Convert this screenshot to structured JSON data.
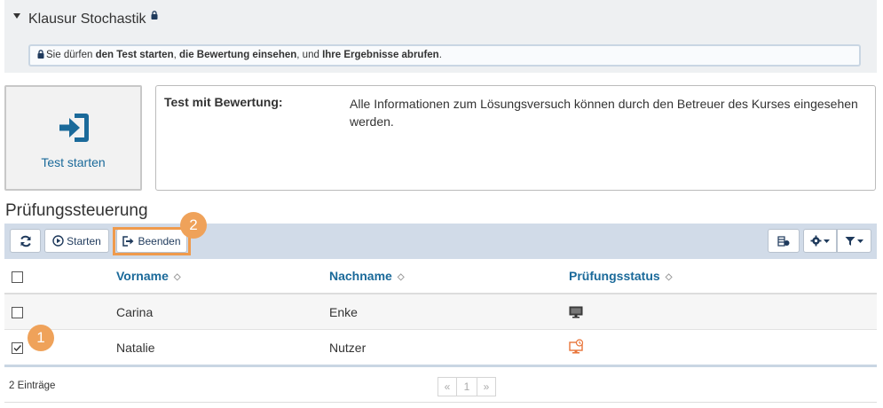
{
  "course": {
    "title": "Klausur Stochastik",
    "notice": {
      "prefix": "Sie dürfen ",
      "bold1": "den Test starten",
      "sep1": ", ",
      "bold2": "die Bewertung einsehen",
      "sep2": ", und ",
      "bold3": "Ihre Ergebnisse abrufen",
      "suffix": "."
    }
  },
  "start_tile": {
    "label": "Test starten"
  },
  "info": {
    "key": "Test mit Bewertung:",
    "value": "Alle Informationen zum Lösungsversuch können durch den Betreuer des Kurses eingesehen werden."
  },
  "section": {
    "title": "Prüfungssteuerung"
  },
  "toolbar": {
    "start_label": "Starten",
    "end_label": "Beenden"
  },
  "table": {
    "headers": {
      "firstname": "Vorname",
      "lastname": "Nachname",
      "status": "Prüfungsstatus"
    },
    "rows": [
      {
        "firstname": "Carina",
        "lastname": "Enke",
        "checked": false,
        "status_icon": "monitor-icon"
      },
      {
        "firstname": "Natalie",
        "lastname": "Nutzer",
        "checked": true,
        "status_icon": "monitor-alert-icon"
      }
    ]
  },
  "footer": {
    "count": "2 Einträge",
    "prev": "«",
    "page": "1",
    "next": "»"
  },
  "markers": {
    "first": "1",
    "second": "2"
  },
  "colors": {
    "accent": "#1b6a9a",
    "toolbar_bg": "#d1dbe8",
    "marker": "#efa25a",
    "highlight": "#ef9a4c",
    "alert": "#e8753a"
  }
}
